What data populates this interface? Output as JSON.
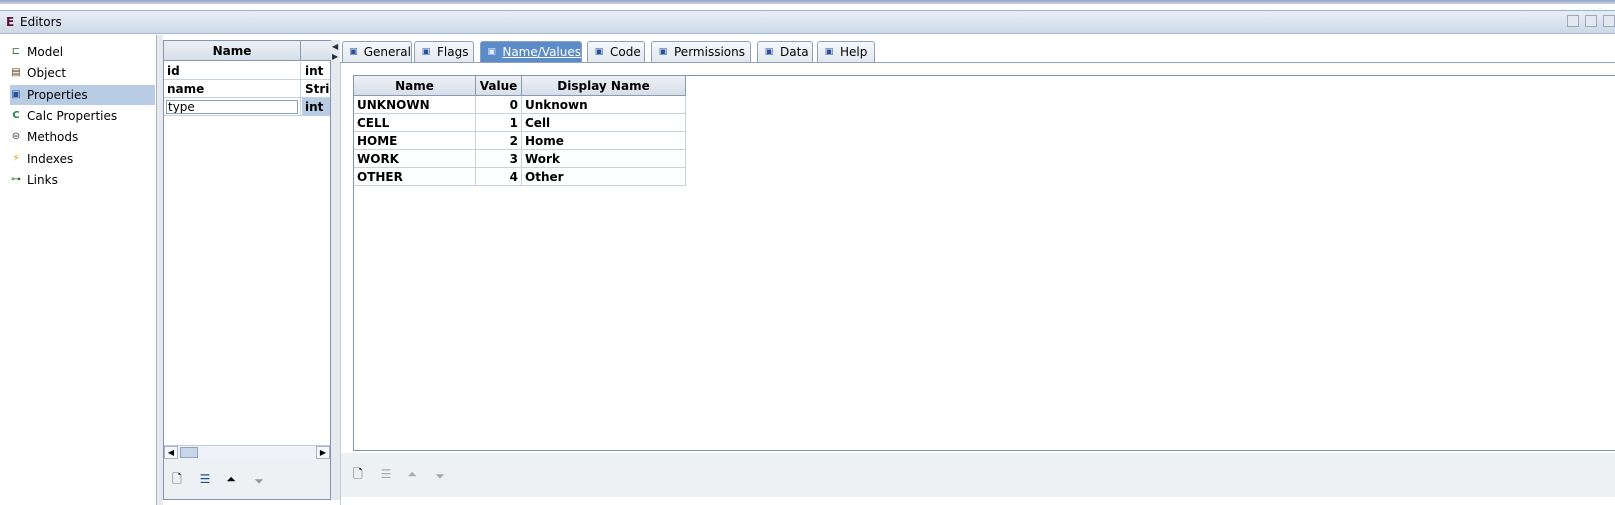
{
  "window": {
    "title": "Editors"
  },
  "nav": {
    "items": [
      {
        "label": "Model",
        "icon": "model-icon"
      },
      {
        "label": "Object",
        "icon": "object-icon"
      },
      {
        "label": "Properties",
        "icon": "properties-icon",
        "selected": true
      },
      {
        "label": "Calc Properties",
        "icon": "calc-properties-icon"
      },
      {
        "label": "Methods",
        "icon": "methods-icon"
      },
      {
        "label": "Indexes",
        "icon": "indexes-icon"
      },
      {
        "label": "Links",
        "icon": "links-icon"
      }
    ]
  },
  "properties_table": {
    "header": {
      "name": "Name",
      "type": ""
    },
    "rows": [
      {
        "name": "id",
        "type": "int"
      },
      {
        "name": "name",
        "type": "Stri"
      },
      {
        "name": "type",
        "type": "int",
        "editing": true
      }
    ]
  },
  "tabs": [
    {
      "label": "General"
    },
    {
      "label": "Flags"
    },
    {
      "label": "Name/Values",
      "active": true
    },
    {
      "label": "Code"
    },
    {
      "label": "Permissions"
    },
    {
      "label": "Data"
    },
    {
      "label": "Help"
    }
  ],
  "name_values": {
    "columns": [
      "Name",
      "Value",
      "Display Name"
    ],
    "rows": [
      {
        "name": "UNKNOWN",
        "value": "0",
        "display": "Unknown"
      },
      {
        "name": "CELL",
        "value": "1",
        "display": "Cell"
      },
      {
        "name": "HOME",
        "value": "2",
        "display": "Home"
      },
      {
        "name": "WORK",
        "value": "3",
        "display": "Work"
      },
      {
        "name": "OTHER",
        "value": "4",
        "display": "Other"
      }
    ]
  },
  "colors": {
    "selection": "#b8cde4",
    "active_tab": "#5b8bc8",
    "title_gradient_top": "#e8eef6"
  }
}
